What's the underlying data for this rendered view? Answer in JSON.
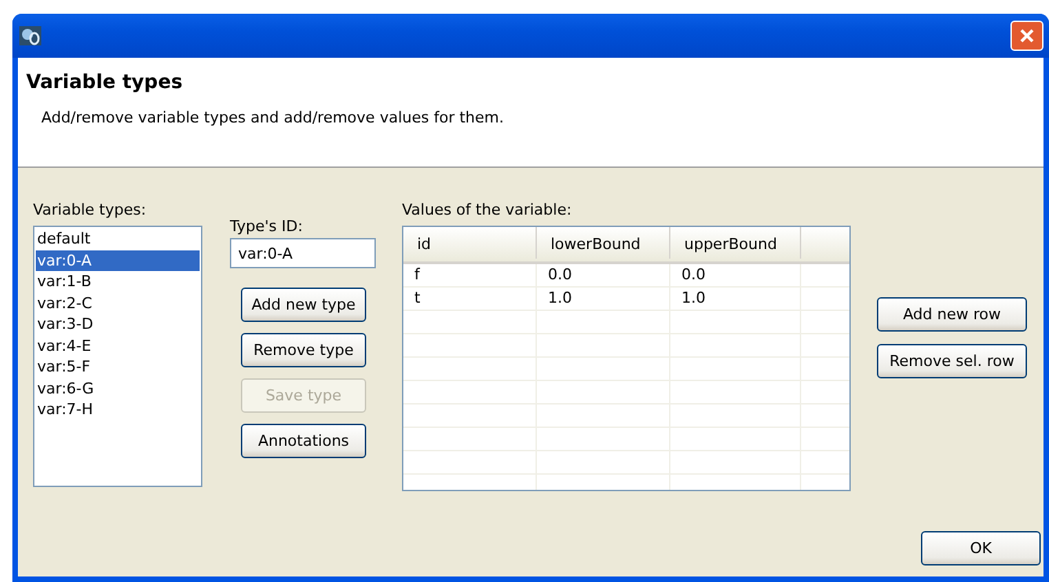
{
  "window": {
    "title_icon": true
  },
  "header": {
    "title": "Variable types",
    "description": "Add/remove variable types and add/remove values for them."
  },
  "types": {
    "label": "Variable types:",
    "items": [
      {
        "label": "default",
        "selected": false
      },
      {
        "label": "var:0-A",
        "selected": true
      },
      {
        "label": "var:1-B",
        "selected": false
      },
      {
        "label": "var:2-C",
        "selected": false
      },
      {
        "label": "var:3-D",
        "selected": false
      },
      {
        "label": "var:4-E",
        "selected": false
      },
      {
        "label": "var:5-F",
        "selected": false
      },
      {
        "label": "var:6-G",
        "selected": false
      },
      {
        "label": "var:7-H",
        "selected": false
      }
    ]
  },
  "type_id": {
    "label": "Type's ID:",
    "value": "var:0-A"
  },
  "type_buttons": [
    {
      "label": "Add new type",
      "disabled": false
    },
    {
      "label": "Remove type",
      "disabled": false
    },
    {
      "label": "Save type",
      "disabled": true
    },
    {
      "label": "Annotations",
      "disabled": false
    }
  ],
  "values": {
    "label": "Values of the variable:",
    "columns": [
      "id",
      "lowerBound",
      "upperBound"
    ],
    "rows": [
      [
        "f",
        "0.0",
        "0.0"
      ],
      [
        "t",
        "1.0",
        "1.0"
      ]
    ]
  },
  "row_buttons": [
    {
      "label": "Add new row",
      "disabled": false
    },
    {
      "label": "Remove sel. row",
      "disabled": false
    }
  ],
  "ok_button": {
    "label": "OK"
  }
}
